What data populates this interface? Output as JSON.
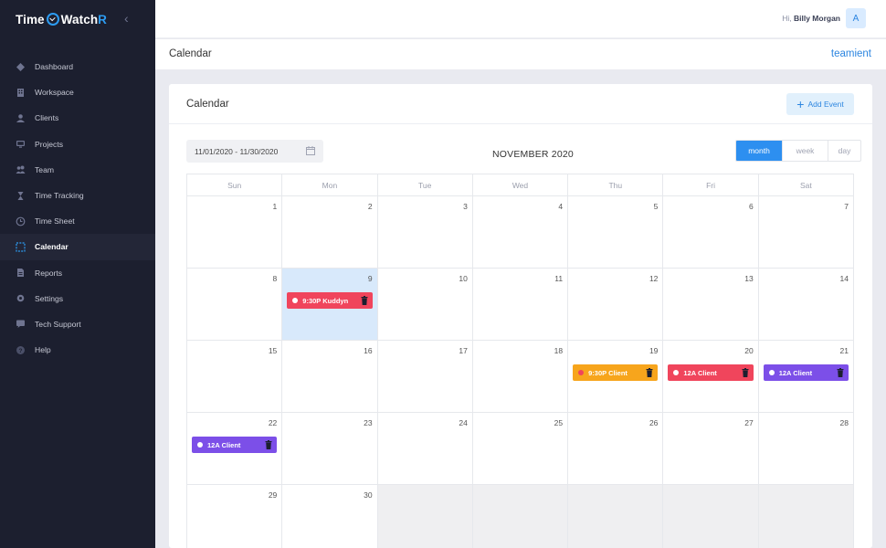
{
  "app": {
    "logo_part1": "Time",
    "logo_part2": "Watch",
    "logo_part3": "R"
  },
  "sidebar": {
    "items": [
      {
        "label": "Dashboard",
        "icon": "dashboard-icon"
      },
      {
        "label": "Workspace",
        "icon": "building-icon"
      },
      {
        "label": "Clients",
        "icon": "user-icon"
      },
      {
        "label": "Projects",
        "icon": "monitor-icon"
      },
      {
        "label": "Team",
        "icon": "team-icon"
      },
      {
        "label": "Time Tracking",
        "icon": "hourglass-icon"
      },
      {
        "label": "Time Sheet",
        "icon": "clock-icon"
      },
      {
        "label": "Calendar",
        "icon": "calendar-icon",
        "active": true
      },
      {
        "label": "Reports",
        "icon": "report-icon"
      },
      {
        "label": "Settings",
        "icon": "gear-icon"
      },
      {
        "label": "Tech Support",
        "icon": "support-icon"
      },
      {
        "label": "Help",
        "icon": "help-icon"
      }
    ]
  },
  "header": {
    "greeting": "Hi,",
    "user_name": "Billy Morgan",
    "avatar_letter": "A"
  },
  "subheader": {
    "title": "Calendar",
    "brand": "teamient"
  },
  "card": {
    "title": "Calendar",
    "add_event_label": "Add Event"
  },
  "toolbar": {
    "date_range": "11/01/2020 - 11/30/2020",
    "month_title": "NOVEMBER 2020",
    "views": [
      "month",
      "week",
      "day"
    ],
    "active_view": "month"
  },
  "calendar": {
    "weekdays": [
      "Sun",
      "Mon",
      "Tue",
      "Wed",
      "Thu",
      "Fri",
      "Sat"
    ],
    "weeks": [
      [
        "1",
        "2",
        "3",
        "4",
        "5",
        "6",
        "7"
      ],
      [
        "8",
        "9",
        "10",
        "11",
        "12",
        "13",
        "14"
      ],
      [
        "15",
        "16",
        "17",
        "18",
        "19",
        "20",
        "21"
      ],
      [
        "22",
        "23",
        "24",
        "25",
        "26",
        "27",
        "28"
      ],
      [
        "29",
        "30",
        "",
        "",
        "",
        "",
        ""
      ]
    ],
    "today": "9",
    "events": [
      {
        "day": "9",
        "label": "9:30P Kuddyn",
        "color": "#f0455c",
        "dot": "#ffffff"
      },
      {
        "day": "19",
        "label": "9:30P Client",
        "color": "#f7a51c",
        "dot": "#f0455c"
      },
      {
        "day": "20",
        "label": "12A Client",
        "color": "#f0455c",
        "dot": "#ffffff"
      },
      {
        "day": "21",
        "label": "12A Client",
        "color": "#7c4fe8",
        "dot": "#ffffff"
      },
      {
        "day": "22",
        "label": "12A Client",
        "color": "#7c4fe8",
        "dot": "#ffffff"
      }
    ]
  }
}
